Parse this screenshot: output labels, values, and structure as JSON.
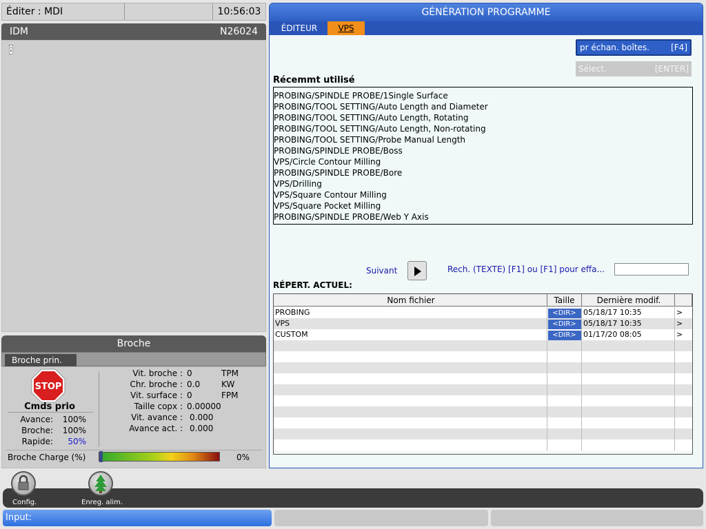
{
  "header": {
    "mode": "Éditer : MDI",
    "clock": "10:56:03"
  },
  "idm": {
    "title": "IDM",
    "program": "N26024",
    "cursor_char": ";"
  },
  "broche": {
    "title": "Broche",
    "tab": "Broche prin.",
    "stop_label": "STOP",
    "cmds_prio": "Cmds prio",
    "overrides": [
      {
        "label": "Avance:",
        "value": "100%"
      },
      {
        "label": "Broche:",
        "value": "100%"
      },
      {
        "label": "Rapide:",
        "value": "50%"
      }
    ],
    "stats": [
      {
        "label": "Vit. broche :",
        "value": "0",
        "unit": "TPM"
      },
      {
        "label": "Chr. broche :",
        "value": "0.0",
        "unit": "KW"
      },
      {
        "label": "Vit. surface :",
        "value": "0",
        "unit": "FPM"
      },
      {
        "label": "Taille copx :",
        "value": "0.00000",
        "unit": ""
      },
      {
        "label": "Vit. avance :",
        "value": "0.000",
        "unit": ""
      },
      {
        "label": "Avance act. :",
        "value": "0.000",
        "unit": ""
      }
    ],
    "charge_label": "Broche Charge (%)",
    "charge_value": "0%",
    "charge_level": 0
  },
  "gen": {
    "title": "GÉNÉRATION PROGRAMME",
    "tabs": [
      "ÉDITEUR",
      "VPS"
    ],
    "btn_f4": {
      "label": "pr échan. boîtes.",
      "key": "[F4]"
    },
    "btn_enter": {
      "label": "Sélect.",
      "key": "[ENTER]"
    },
    "recent_title": "Récemmt utilisé",
    "recent": [
      "PROBING/SPINDLE PROBE/1Single Surface",
      "PROBING/TOOL SETTING/Auto Length and Diameter",
      "PROBING/TOOL SETTING/Auto Length, Rotating",
      "PROBING/TOOL SETTING/Auto Length, Non-rotating",
      "PROBING/TOOL SETTING/Probe Manual Length",
      "PROBING/SPINDLE PROBE/Boss",
      "VPS/Circle Contour Milling",
      "PROBING/SPINDLE PROBE/Bore",
      "VPS/Drilling",
      "VPS/Square Contour Milling",
      "VPS/Square Pocket Milling",
      "PROBING/SPINDLE PROBE/Web Y Axis"
    ],
    "suivant": "Suivant",
    "search_label": "Rech. (TEXTE) [F1] ou [F1] pour effa...",
    "search_value": "",
    "dir_title": "RÉPERT. ACTUEL:",
    "table_headers": [
      "Nom fichier",
      "Taille",
      "Dernière modif.",
      ""
    ],
    "files": [
      {
        "name": "PROBING",
        "size": "<DIR>",
        "date": "05/18/17 10:35",
        "arrow": ">"
      },
      {
        "name": "VPS",
        "size": "<DIR>",
        "date": "05/18/17 10:35",
        "arrow": ">"
      },
      {
        "name": "CUSTOM",
        "size": "<DIR>",
        "date": "01/17/20 08:05",
        "arrow": ">"
      }
    ]
  },
  "bottom": {
    "config": "Config.",
    "enreg": "Enreg. alim."
  },
  "input": {
    "label": "Input:"
  }
}
